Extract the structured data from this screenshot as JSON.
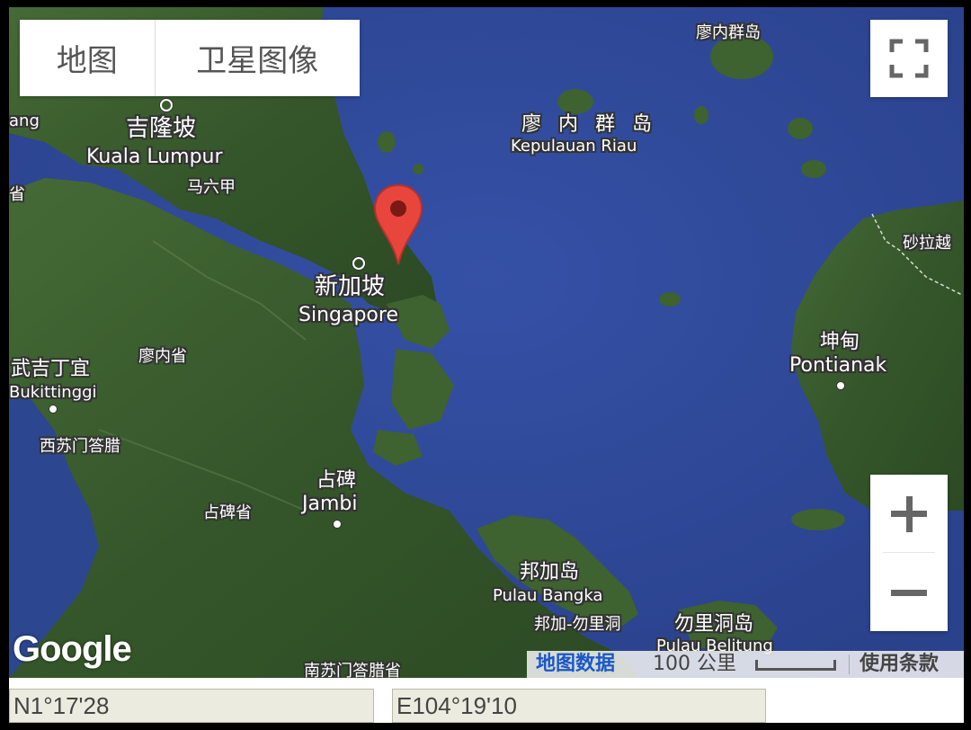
{
  "map_type": {
    "map_label": "地图",
    "satellite_label": "卫星图像"
  },
  "labels": {
    "liaonei_islands": "廖内群岛",
    "kepulauan_riau_cn": "廖 内 群 岛",
    "kepulauan_riau": "Kepulauan Riau",
    "kuala_lumpur_cn": "吉隆坡",
    "kuala_lumpur": "Kuala Lumpur",
    "malacca": "马六甲",
    "singapore_cn": "新加坡",
    "singapore": "Singapore",
    "riau_province": "廖内省",
    "bukittinggi_cn": "武吉丁宜",
    "bukittinggi": "Bukittinggi",
    "west_sumatra": "西苏门答腊",
    "jambi_cn": "占碑",
    "jambi": "Jambi",
    "jambi_province": "占碑省",
    "sarawak": "砂拉越",
    "pontianak_cn": "坤甸",
    "pontianak": "Pontianak",
    "bangka_cn": "邦加岛",
    "bangka": "Pulau Bangka",
    "bangka_belitung": "邦加-勿里洞",
    "belitung_cn": "勿里洞岛",
    "belitung": "Pulau Belitung",
    "south_sumatra": "南苏门答腊省",
    "edge_top_left": "ang",
    "edge_left_province": "省"
  },
  "attribution": {
    "map_data": "地图数据",
    "scale": "100 公里",
    "terms": "使用条款"
  },
  "logo": "Google",
  "coordinates": {
    "latitude": "N1°17'28",
    "longitude": "E104°19'10"
  },
  "marker": {
    "icon": "map-pin-icon",
    "color": "#e8453c"
  },
  "colors": {
    "sea": "#2f4a9a",
    "land": "#3a5a2c"
  }
}
